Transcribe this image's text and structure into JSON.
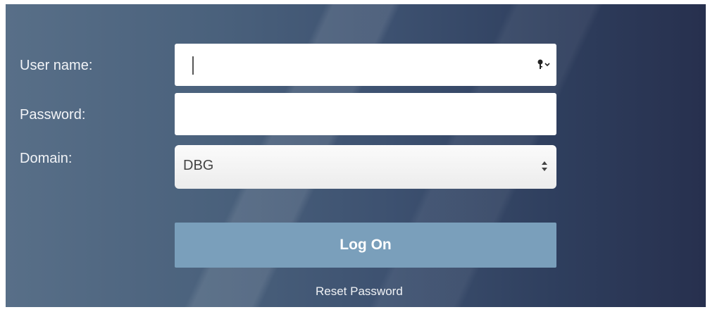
{
  "form": {
    "username_label": "User name:",
    "password_label": "Password:",
    "domain_label": "Domain:",
    "username_value": "",
    "password_value": "",
    "domain_value": "DBG"
  },
  "actions": {
    "logon_label": "Log On",
    "reset_password_label": "Reset Password"
  },
  "icons": {
    "username_trailing": "key-icon",
    "domain_trailing": "stepper-icon"
  },
  "colors": {
    "panel_left": "#586f88",
    "panel_right": "#27304e",
    "button": "#7a9fbb"
  }
}
